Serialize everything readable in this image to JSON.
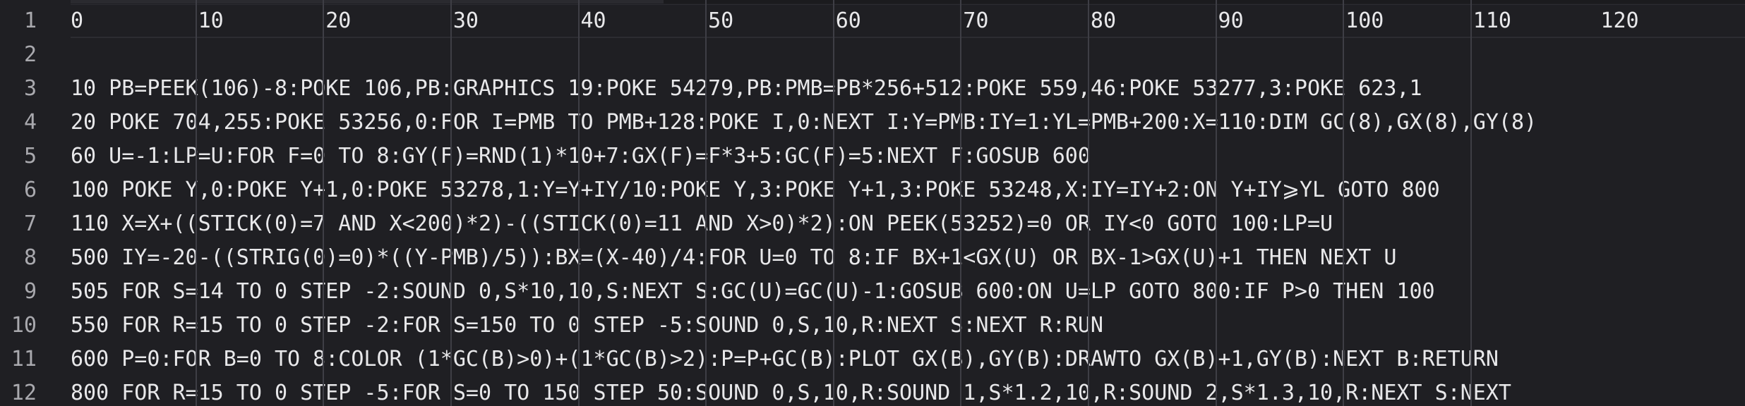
{
  "editor": {
    "ruler_columns": [
      10,
      20,
      30,
      40,
      50,
      60,
      70,
      80,
      90,
      100,
      110
    ],
    "lines": [
      {
        "number": "1",
        "text": "0         10        20        30        40        50        60        70        80        90        100       110       120"
      },
      {
        "number": "2",
        "text": ""
      },
      {
        "number": "3",
        "text": "10 PB=PEEK(106)-8:POKE 106,PB:GRAPHICS 19:POKE 54279,PB:PMB=PB*256+512:POKE 559,46:POKE 53277,3:POKE 623,1"
      },
      {
        "number": "4",
        "text": "20 POKE 704,255:POKE 53256,0:FOR I=PMB TO PMB+128:POKE I,0:NEXT I:Y=PMB:IY=1:YL=PMB+200:X=110:DIM GC(8),GX(8),GY(8)"
      },
      {
        "number": "5",
        "text": "60 U=-1:LP=U:FOR F=0 TO 8:GY(F)=RND(1)*10+7:GX(F)=F*3+5:GC(F)=5:NEXT F:GOSUB 600"
      },
      {
        "number": "6",
        "text": "100 POKE Y,0:POKE Y+1,0:POKE 53278,1:Y=Y+IY/10:POKE Y,3:POKE Y+1,3:POKE 53248,X:IY=IY+2:ON Y+IY⩾YL GOTO 800"
      },
      {
        "number": "7",
        "text": "110 X=X+((STICK(0)=7 AND X<200)*2)-((STICK(0)=11 AND X>0)*2):ON PEEK(53252)=0 OR IY<0 GOTO 100:LP=U"
      },
      {
        "number": "8",
        "text": "500 IY=-20-((STRIG(0)=0)*((Y-PMB)/5)):BX=(X-40)/4:FOR U=0 TO 8:IF BX+1<GX(U) OR BX-1>GX(U)+1 THEN NEXT U"
      },
      {
        "number": "9",
        "text": "505 FOR S=14 TO 0 STEP -2:SOUND 0,S*10,10,S:NEXT S:GC(U)=GC(U)-1:GOSUB 600:ON U=LP GOTO 800:IF P>0 THEN 100"
      },
      {
        "number": "10",
        "text": "550 FOR R=15 TO 0 STEP -2:FOR S=150 TO 0 STEP -5:SOUND 0,S,10,R:NEXT S:NEXT R:RUN"
      },
      {
        "number": "11",
        "text": "600 P=0:FOR B=0 TO 8:COLOR (1*GC(B)>0)+(1*GC(B)>2):P=P+GC(B):PLOT GX(B),GY(B):DRAWTO GX(B)+1,GY(B):NEXT B:RETURN"
      },
      {
        "number": "12",
        "text": "800 FOR R=15 TO 0 STEP -5:FOR S=0 TO 150 STEP 50:SOUND 0,S,10,R:SOUND 1,S*1.2,10,R:SOUND 2,S*1.3,10,R:NEXT S:NEXT"
      }
    ]
  }
}
